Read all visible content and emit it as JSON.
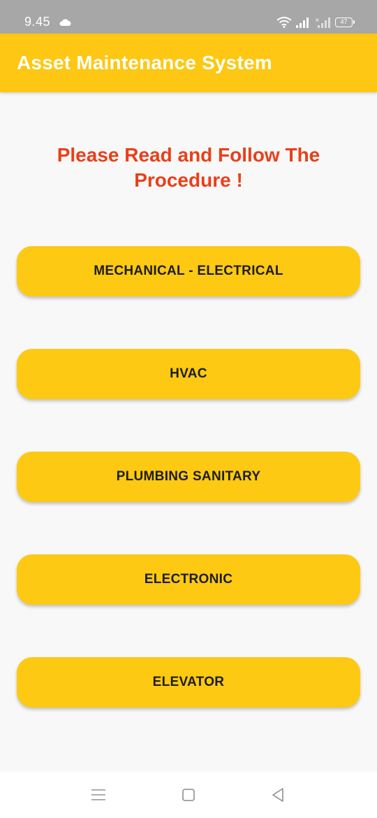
{
  "status_bar": {
    "time": "9.45",
    "battery": "47",
    "icons": [
      "cloud-icon",
      "wifi-icon",
      "signal-icon",
      "signal-no-sim-icon",
      "battery-icon"
    ]
  },
  "app_bar": {
    "title": "Asset Maintenance System",
    "color": "#fdc713"
  },
  "main": {
    "heading": "Please Read and Follow The Procedure !",
    "heading_color": "#e8401a",
    "buttons": [
      {
        "label": "MECHANICAL - ELECTRICAL"
      },
      {
        "label": "HVAC"
      },
      {
        "label": "PLUMBING SANITARY"
      },
      {
        "label": "ELECTRONIC"
      },
      {
        "label": "ELEVATOR"
      }
    ]
  },
  "nav_bar": {
    "icons": [
      "menu-icon",
      "home-icon",
      "back-icon"
    ]
  }
}
